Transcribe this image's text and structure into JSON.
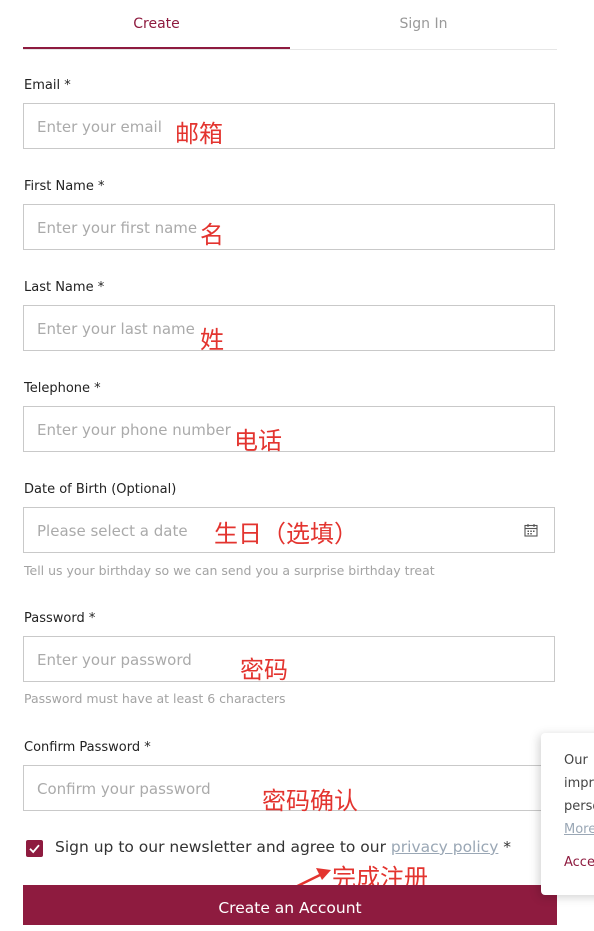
{
  "tabs": {
    "create": "Create",
    "signin": "Sign In"
  },
  "fields": {
    "email": {
      "label": "Email *",
      "placeholder": "Enter your email",
      "note": "邮箱"
    },
    "first_name": {
      "label": "First Name *",
      "placeholder": "Enter your first name",
      "note": "名"
    },
    "last_name": {
      "label": "Last Name *",
      "placeholder": "Enter your last name",
      "note": "姓"
    },
    "telephone": {
      "label": "Telephone *",
      "placeholder": "Enter your phone number",
      "note": "电话"
    },
    "dob": {
      "label": "Date of Birth (Optional)",
      "placeholder": "Please select a date",
      "note": "生日（选填）",
      "hint": "Tell us your birthday so we can send you a surprise birthday treat"
    },
    "password": {
      "label": "Password *",
      "placeholder": "Enter your password",
      "note": "密码",
      "hint": "Password must have at least 6 characters"
    },
    "confirm": {
      "label": "Confirm Password *",
      "placeholder": "Confirm your password",
      "note": "密码确认"
    }
  },
  "newsletter": {
    "text_before": "Sign up to our newsletter and agree to our ",
    "link": "privacy policy",
    "text_after": " *",
    "checked": true
  },
  "submit": {
    "label": "Create an Account",
    "note": "完成注册"
  },
  "cookie": {
    "line1": "Our",
    "line2": "impr",
    "line3": "perso",
    "more": "More",
    "accept": "Acce"
  },
  "colors": {
    "accent": "#8e1b3f",
    "annotation": "#e3342f"
  }
}
